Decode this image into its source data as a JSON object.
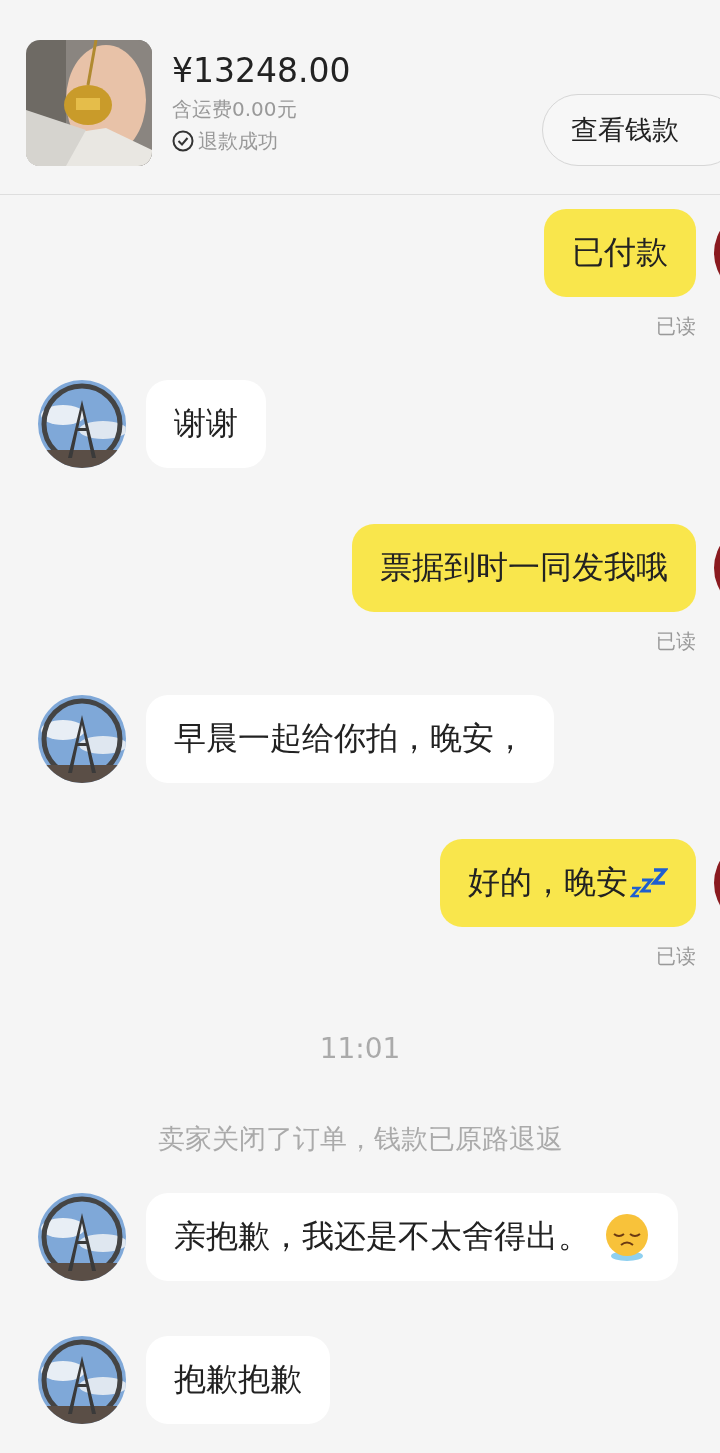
{
  "order": {
    "price": "¥13248.00",
    "shipping": "含运费0.00元",
    "status": "退款成功",
    "button": "查看钱款"
  },
  "messages": [
    {
      "kind": "sent",
      "text": "已付款",
      "read": "已读"
    },
    {
      "kind": "received",
      "text": "谢谢"
    },
    {
      "kind": "sent",
      "text": "票据到时一同发我哦",
      "read": "已读"
    },
    {
      "kind": "received",
      "text": "早晨一起给你拍，晚安，"
    },
    {
      "kind": "sent",
      "text": "好的，晚安",
      "sleep_icon": true,
      "read": "已读"
    },
    {
      "kind": "time",
      "text": "11:01"
    },
    {
      "kind": "system",
      "text": "卖家关闭了订单，钱款已原路退返"
    },
    {
      "kind": "received",
      "text": "亲抱歉，我还是不太舍得出。",
      "face_icon": true
    },
    {
      "kind": "received",
      "text": "抱歉抱歉"
    }
  ]
}
